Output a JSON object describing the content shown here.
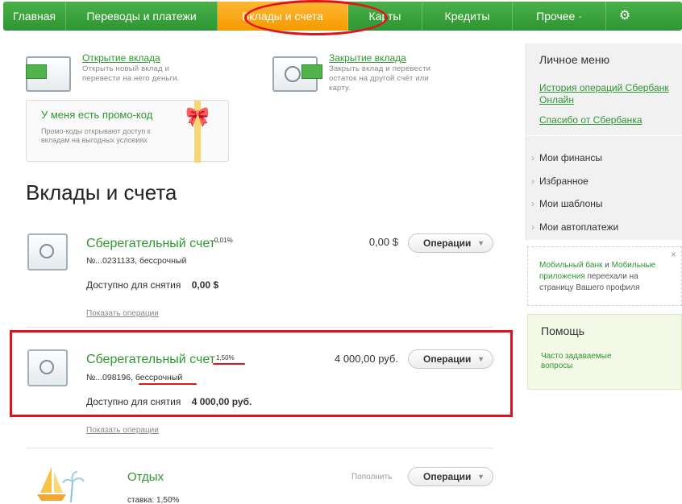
{
  "nav": {
    "items": [
      "Главная",
      "Переводы и платежи",
      "Вклады и счета",
      "Карты",
      "Кредиты",
      "Прочее ·"
    ],
    "active_index": 2,
    "gear_icon": "gear-icon"
  },
  "actions": {
    "open": {
      "link": "Открытие вклада",
      "desc": "Открыть новый вклад и перевести на него деньги."
    },
    "close": {
      "link": "Закрытие вклада",
      "desc": "Закрыть вклад и перевести остаток на другой счёт или карту."
    }
  },
  "promo": {
    "title": "У меня есть промо-код",
    "desc": "Промо-коды открывают доступ к вкладам на выгодных условиях"
  },
  "page_title": "Вклады и счета",
  "accounts": [
    {
      "name": "Сберегательный счет",
      "rate": "0,01%",
      "number": "№...0231133, бессрочный",
      "available_label": "Доступно для снятия",
      "available_value": "0,00 $",
      "amount": "0,00 $",
      "ops_label": "Операции",
      "show_ops": "Показать операции"
    },
    {
      "name": "Сберегательный счет",
      "rate": "1,50%",
      "number": "№...098196",
      "term": ", бессрочный",
      "available_label": "Доступно для снятия",
      "available_value": "4 000,00 руб.",
      "amount": "4 000,00 руб.",
      "ops_label": "Операции",
      "show_ops": "Показать операции"
    }
  ],
  "vacation": {
    "name": "Отдых",
    "subtitle": "ставка: 1,50%",
    "topup": "Пополнить",
    "ops_label": "Операции"
  },
  "sidebar": {
    "title": "Личное меню",
    "links": [
      "История операций Сбербанк Онлайн",
      "Спасибо от Сбербанка"
    ],
    "items": [
      "Мои финансы",
      "Избранное",
      "Мои шаблоны",
      "Мои автоплатежи"
    ]
  },
  "notice": {
    "part1": "Мобильный банк",
    "part2": " и ",
    "part3": "Мобильные приложения",
    "part4": " переехали на страницу Вашего профиля",
    "close": "×"
  },
  "help": {
    "title": "Помощь",
    "link": "Часто задаваемые вопросы"
  },
  "colors": {
    "brand_green": "#2e9632",
    "active_orange": "#f59a00",
    "annotation_red": "#e3131b"
  }
}
